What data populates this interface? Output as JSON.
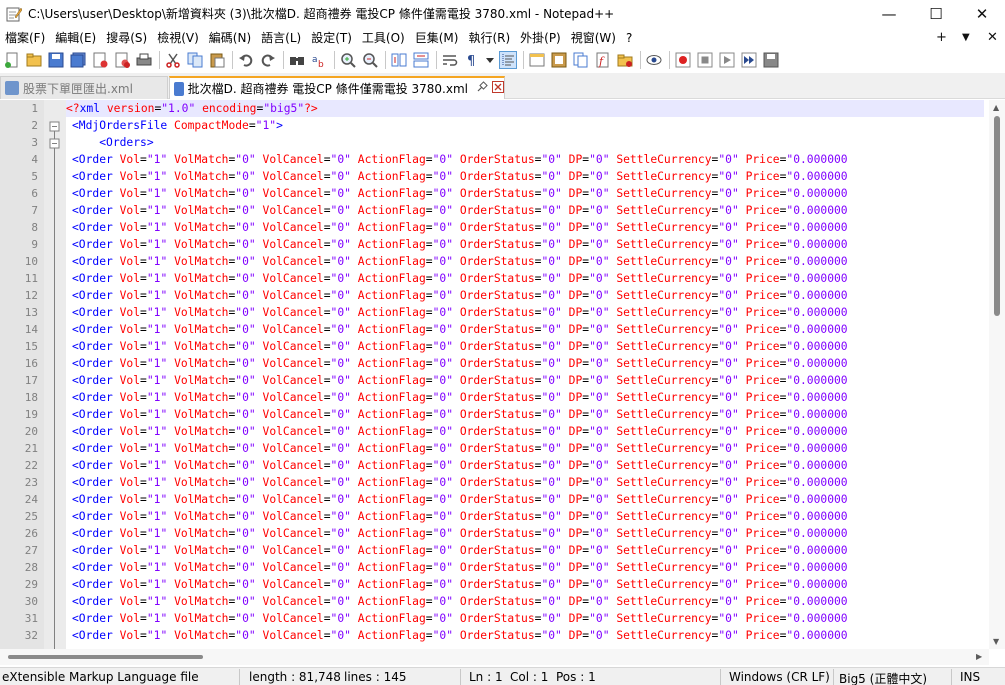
{
  "window": {
    "title": "C:\\Users\\user\\Desktop\\新增資料夾 (3)\\批次檔D. 超商禮券 電投CP 條件僅需電投 3780.xml - Notepad++",
    "minimize": "—",
    "maximize": "☐",
    "close": "✕"
  },
  "menu": {
    "items": [
      "檔案(F)",
      "編輯(E)",
      "搜尋(S)",
      "檢視(V)",
      "編碼(N)",
      "語言(L)",
      "設定(T)",
      "工具(O)",
      "巨集(M)",
      "執行(R)",
      "外掛(P)",
      "視窗(W)",
      "?"
    ],
    "plus": "+",
    "dropdown": "▼",
    "close": "✕"
  },
  "tabs": [
    {
      "label": "股票下單匣匯出.xml",
      "active": false
    },
    {
      "label": "批次檔D. 超商禮券 電投CP 條件僅需電投 3780.xml",
      "active": true
    }
  ],
  "editor": {
    "line_numbers": [
      "1",
      "2",
      "3",
      "4",
      "5",
      "6",
      "7",
      "8",
      "9",
      "10",
      "11",
      "12",
      "13",
      "14",
      "15",
      "16",
      "17",
      "18",
      "19",
      "20",
      "21",
      "22",
      "23",
      "24",
      "25",
      "26",
      "27",
      "28",
      "29",
      "30",
      "31",
      "32"
    ],
    "header_lines": {
      "line1": {
        "open": "<?",
        "name": "xml",
        "a1": "version",
        "v1": "\"1.0\"",
        "a2": "encoding",
        "v2": "\"big5\"",
        "close": "?>"
      },
      "line2": {
        "open": "<",
        "name": "MdjOrdersFile",
        "a1": "CompactMode",
        "v1": "\"1\"",
        "close": ">"
      },
      "line3": {
        "indent": "    ",
        "text": "<Orders>"
      }
    },
    "order_line": {
      "tag": "<Order",
      "attrs": [
        {
          "name": "Vol",
          "value": "\"1\""
        },
        {
          "name": "VolMatch",
          "value": "\"0\""
        },
        {
          "name": "VolCancel",
          "value": "\"0\""
        },
        {
          "name": "ActionFlag",
          "value": "\"0\""
        },
        {
          "name": "OrderStatus",
          "value": "\"0\""
        },
        {
          "name": "DP",
          "value": "\"0\""
        },
        {
          "name": "SettleCurrency",
          "value": "\"0\""
        },
        {
          "name": "Price",
          "value": "\"0.000000"
        }
      ]
    },
    "order_line_count": 29
  },
  "statusbar": {
    "filetype": "eXtensible Markup Language file",
    "length": "length : 81,748",
    "lines": "lines : 145",
    "ln": "Ln : 1",
    "col": "Col : 1",
    "pos": "Pos : 1",
    "eol": "Windows (CR LF)",
    "encoding": "Big5 (正體中文)",
    "mode": "INS"
  },
  "colors": {
    "tag": "#0000ff",
    "attribute": "#ff0000",
    "value": "#8000ff",
    "tab_accent": "#f5a623",
    "current_line": "#e8e8ff"
  }
}
